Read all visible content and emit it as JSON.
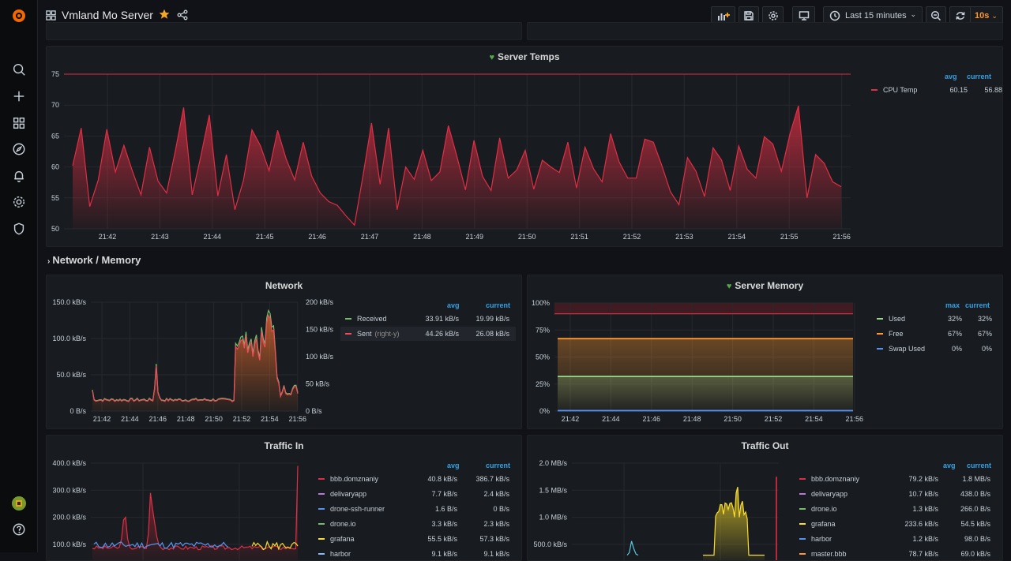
{
  "topbar": {
    "title": "Vmland Mo Server",
    "time_range": "Last 15 minutes",
    "refresh": "10s"
  },
  "row": {
    "title": "Network / Memory"
  },
  "temps": {
    "title": "Server Temps",
    "y_ticks": [
      "75",
      "70",
      "65",
      "60",
      "55",
      "50"
    ],
    "x_ticks": [
      "21:42",
      "21:43",
      "21:44",
      "21:45",
      "21:46",
      "21:47",
      "21:48",
      "21:49",
      "21:50",
      "21:51",
      "21:52",
      "21:53",
      "21:54",
      "21:55",
      "21:56"
    ],
    "legend_headers": [
      "avg",
      "current"
    ],
    "legend": [
      {
        "name": "CPU Temp",
        "avg": "60.15",
        "current": "56.88",
        "color": "#e02f44"
      }
    ],
    "threshold": 75
  },
  "network": {
    "title": "Network",
    "y_left": [
      "150.0 kB/s",
      "100.0 kB/s",
      "50.0 kB/s",
      "0 B/s"
    ],
    "y_right": [
      "200 kB/s",
      "150 kB/s",
      "100 kB/s",
      "50 kB/s",
      "0 B/s"
    ],
    "x_ticks": [
      "21:42",
      "21:44",
      "21:46",
      "21:48",
      "21:50",
      "21:52",
      "21:54",
      "21:56"
    ],
    "legend_headers": [
      "avg",
      "current"
    ],
    "legend": [
      {
        "name": "Received",
        "suffix": "",
        "avg": "33.91 kB/s",
        "current": "19.99 kB/s",
        "color": "#73bf69"
      },
      {
        "name": "Sent",
        "suffix": "(right-y)",
        "avg": "44.26 kB/s",
        "current": "26.08 kB/s",
        "color": "#f2495c"
      }
    ]
  },
  "memory": {
    "title": "Server Memory",
    "y_ticks": [
      "100%",
      "75%",
      "50%",
      "25%",
      "0%"
    ],
    "x_ticks": [
      "21:42",
      "21:44",
      "21:46",
      "21:48",
      "21:50",
      "21:52",
      "21:54",
      "21:56"
    ],
    "legend_headers": [
      "max",
      "current"
    ],
    "legend": [
      {
        "name": "Used",
        "max": "32%",
        "current": "32%",
        "color": "#96d98d"
      },
      {
        "name": "Free",
        "max": "67%",
        "current": "67%",
        "color": "#ff9830"
      },
      {
        "name": "Swap Used",
        "max": "0%",
        "current": "0%",
        "color": "#5794f2"
      }
    ]
  },
  "traffic_in": {
    "title": "Traffic In",
    "y_ticks": [
      "400.0 kB/s",
      "300.0 kB/s",
      "200.0 kB/s",
      "100.0 kB/s"
    ],
    "legend_headers": [
      "avg",
      "current"
    ],
    "legend": [
      {
        "name": "bbb.domznaniy",
        "avg": "40.8 kB/s",
        "current": "386.7 kB/s",
        "color": "#e02f44"
      },
      {
        "name": "delivaryapp",
        "avg": "7.7 kB/s",
        "current": "2.4 kB/s",
        "color": "#b877d9"
      },
      {
        "name": "drone-ssh-runner",
        "avg": "1.6 B/s",
        "current": "0 B/s",
        "color": "#5794f2"
      },
      {
        "name": "drone.io",
        "avg": "3.3 kB/s",
        "current": "2.3 kB/s",
        "color": "#73bf69"
      },
      {
        "name": "grafana",
        "avg": "55.5 kB/s",
        "current": "57.3 kB/s",
        "color": "#fade2a"
      },
      {
        "name": "harbor",
        "avg": "9.1 kB/s",
        "current": "9.1 kB/s",
        "color": "#8ab8ff"
      }
    ]
  },
  "traffic_out": {
    "title": "Traffic Out",
    "y_ticks": [
      "2.0 MB/s",
      "1.5 MB/s",
      "1.0 MB/s",
      "500.0 kB/s"
    ],
    "legend_headers": [
      "avg",
      "current"
    ],
    "legend": [
      {
        "name": "bbb.domznaniy",
        "avg": "79.2 kB/s",
        "current": "1.8 MB/s",
        "color": "#e02f44"
      },
      {
        "name": "delivaryapp",
        "avg": "10.7 kB/s",
        "current": "438.0 B/s",
        "color": "#b877d9"
      },
      {
        "name": "drone.io",
        "avg": "1.3 kB/s",
        "current": "266.0 B/s",
        "color": "#73bf69"
      },
      {
        "name": "grafana",
        "avg": "233.6 kB/s",
        "current": "54.5 kB/s",
        "color": "#fade2a"
      },
      {
        "name": "harbor",
        "avg": "1.2 kB/s",
        "current": "98.0 B/s",
        "color": "#5794f2"
      },
      {
        "name": "master.bbb",
        "avg": "78.7 kB/s",
        "current": "69.0 kB/s",
        "color": "#ff9830"
      }
    ]
  }
}
